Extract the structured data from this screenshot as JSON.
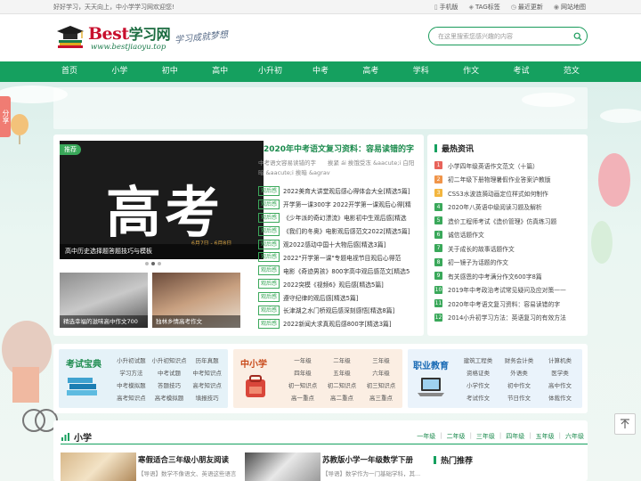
{
  "topbar": {
    "welcome": "好好学习，天天向上，中小学学习网欢迎您!",
    "links": [
      {
        "label": "手机版",
        "icon": "phone-icon"
      },
      {
        "label": "TAG标签",
        "icon": "tag-icon"
      },
      {
        "label": "最近更新",
        "icon": "clock-icon"
      },
      {
        "label": "网站地图",
        "icon": "map-pin-icon"
      }
    ]
  },
  "logo": {
    "main": "Best",
    "cn": "学习网",
    "url": "www.bestjiaoyu.top",
    "slogan": "学习成就梦想"
  },
  "search": {
    "placeholder": "在这里搜索您感兴趣的内容"
  },
  "nav": [
    "首页",
    "小学",
    "初中",
    "高中",
    "小升初",
    "中考",
    "高考",
    "学科",
    "作文",
    "考试",
    "范文"
  ],
  "share": "分享",
  "slider": {
    "tag": "推荐",
    "image_text": "高考",
    "image_date": "6月7日 - 6月8日",
    "caption": "高中历史选择题答题技巧与模板"
  },
  "thumbs": [
    {
      "caption": "精选幸福的滋味高中作文700"
    },
    {
      "caption": "独林乡情高考作文"
    }
  ],
  "middle": {
    "title": "2020年中考语文复习资料：容易读错的字",
    "desc": "中考语文容易读错的字　　挨紧 ái 挨饿受冻 &aacute;i 白阳暗 &aacute;i 挨暗 &agrav",
    "badge": "观后感",
    "items": [
      "2022美育大讲堂观后感心得体会大全[精选5篇]",
      "开学第一课300字 2022开学第一课观后心得[精",
      "《少年派的奇幻漂流》电影初中生观后感[精选",
      "《我们的冬奥》电影观后感范文2022[精选5篇]",
      "观2022感动中国十大物后感[精选3篇]",
      "2022\"开学第一课\"专题电视节目观后心得范",
      "电影《奇迹男孩》800字高中观后感范文[精选5",
      "2022突模《视频6》观后感[精选5篇]",
      "遵守纪律的观后感[精选5篇]",
      "长津湖之水门桥观后感深刻感悟[精选8篇]",
      "2022新闻大求真观后感800字[精选3篇]"
    ]
  },
  "latest": {
    "title": "最热资讯",
    "num_colors": [
      "#e8635a",
      "#f0954a",
      "#f3b63f",
      "#3aa85a",
      "#3aa85a",
      "#3aa85a",
      "#3aa85a",
      "#3aa85a",
      "#3aa85a",
      "#3aa85a",
      "#3aa85a",
      "#3aa85a"
    ],
    "items": [
      "小学四年级英语作文范文（十篇）",
      "初二年级下册物理暑假作业答案沪教版",
      "CSS3水波涟漪动画定位样式如何制作",
      "2020年八英语中级阅读习题及解析",
      "造价工程师考试《造价管理》仿真练习题",
      "诚信话题作文",
      "关于成长的故事话题作文",
      "初一镜子为话题的作文",
      "有关感恩的中考满分作文600字8篇",
      "2019年中考政治考试常见疑问及应对策——",
      "2020年中考语文复习资料：容易读错的字",
      "2014小升初学习方法：英语复习的有效方法"
    ]
  },
  "categories": [
    {
      "title": "考试宝典",
      "links": [
        "小升初试题",
        "小升初知识点",
        "历年真题",
        "学习方法",
        "中考试题",
        "中考知识点",
        "中考模拟题",
        "答题技巧",
        "高考知识点",
        "高考知识点",
        "高考模拟题",
        "填报技巧"
      ]
    },
    {
      "title": "中小学",
      "links": [
        "一年级",
        "二年级",
        "三年级",
        "四年级",
        "五年级",
        "六年级",
        "初一知识点",
        "初二知识点",
        "初三知识点",
        "高一重点",
        "高二重点",
        "高三重点"
      ]
    },
    {
      "title": "职业教育",
      "links": [
        "建筑工程类",
        "财务会计类",
        "计算机类",
        "资格证类",
        "外语类",
        "医学类",
        "小学作文",
        "初中作文",
        "高中作文",
        "考试作文",
        "节日作文",
        "体裁作文"
      ]
    }
  ],
  "section": {
    "title": "小学",
    "grades": [
      "一年级",
      "二年级",
      "三年级",
      "四年级",
      "五年级",
      "六年级"
    ],
    "articles": [
      {
        "title": "寒假适合三年级小朋友阅读",
        "desc": "【导语】数学不像语文、英语这些语言学科..."
      },
      {
        "title": "苏教版小学一年级数学下册",
        "desc": "【导语】数学作为一门基础学科，其..."
      }
    ],
    "hot_title": "热门推荐"
  }
}
